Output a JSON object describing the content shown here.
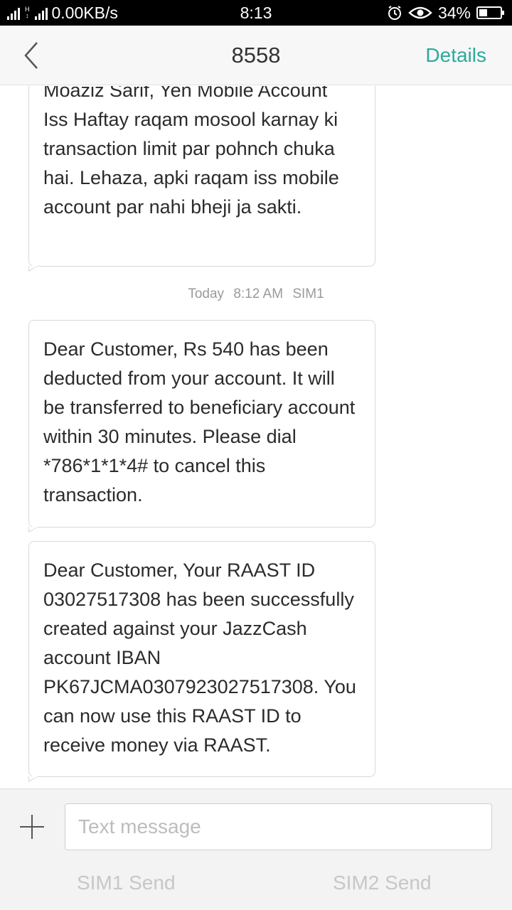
{
  "status_bar": {
    "network_type": "H",
    "data_speed": "0.00KB/s",
    "time": "8:13",
    "battery_percent": "34%",
    "icons": [
      "signal-icon",
      "hplus-icon",
      "signal2-icon",
      "alarm-icon",
      "eye-icon",
      "battery-icon"
    ]
  },
  "header": {
    "title": "8558",
    "details_label": "Details",
    "back_icon": "chevron-left-icon"
  },
  "messages": [
    {
      "partial_top_line": "Moaziz Sarif, Yen Mobile Account",
      "text": "Iss Haftay raqam mosool karnay ki transaction limit par pohnch chuka hai. Lehaza, apki raqam iss mobile account par nahi bheji ja sakti."
    },
    {
      "text": "Dear Customer, Rs 540 has been deducted from your account. It will be transferred to beneficiary account within 30 minutes. Please dial *786*1*1*4# to cancel this transaction."
    },
    {
      "text": "Dear Customer, Your RAAST ID 03027517308 has been successfully created against your JazzCash account IBAN PK67JCMA0307923027517308. You can now use this RAAST ID to receive money via RAAST."
    }
  ],
  "timestamp": {
    "day": "Today",
    "time": "8:12 AM",
    "sim": "SIM1"
  },
  "composer": {
    "placeholder": "Text message",
    "value": "",
    "sim1_send_label": "SIM1 Send",
    "sim2_send_label": "SIM2 Send",
    "add_icon": "plus-icon"
  },
  "colors": {
    "accent": "#2bab9b",
    "status_bar_bg": "#000000",
    "header_bg": "#f7f7f7",
    "composer_bg": "#f3f3f3"
  }
}
